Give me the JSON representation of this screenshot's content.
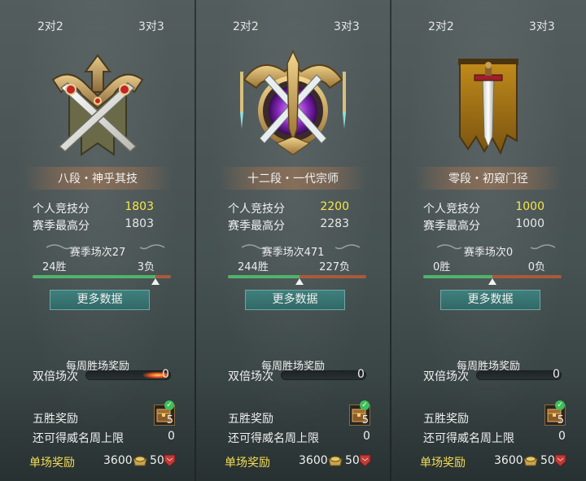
{
  "panels": [
    {
      "tabs": {
        "left": "2对2",
        "right": "3对3"
      },
      "emblem_icon": "crossed-swords-bronze-emblem",
      "rank_name": "八段・神乎其技",
      "personal_score_label": "个人竞技分",
      "personal_score": "1803",
      "season_high_label": "赛季最高分",
      "season_high": "1803",
      "season_matches": "赛季场次27",
      "wins": "24胜",
      "losses": "3负",
      "win_ratio": 0.89,
      "more_button": "更多数据",
      "weekly_title": "每周胜场奖励",
      "double_label": "双倍场次",
      "double_value": "0",
      "five_win_label": "五胜奖励",
      "chest_count": "5",
      "limit_label": "还可得威名周上限",
      "limit_value": "0",
      "single_label": "单场奖励",
      "gold_value": "3600",
      "honor_value": "50"
    },
    {
      "tabs": {
        "left": "2对2",
        "right": "3对3"
      },
      "emblem_icon": "winged-sword-purple-emblem",
      "rank_name": "十二段・一代宗师",
      "personal_score_label": "个人竞技分",
      "personal_score": "2200",
      "season_high_label": "赛季最高分",
      "season_high": "2283",
      "season_matches": "赛季场次471",
      "wins": "244胜",
      "losses": "227负",
      "win_ratio": 0.52,
      "more_button": "更多数据",
      "weekly_title": "每周胜场奖励",
      "double_label": "双倍场次",
      "double_value": "0",
      "five_win_label": "五胜奖励",
      "chest_count": "5",
      "limit_label": "还可得威名周上限",
      "limit_value": "0",
      "single_label": "单场奖励",
      "gold_value": "3600",
      "honor_value": "50"
    },
    {
      "tabs": {
        "left": "2对2",
        "right": "3对3"
      },
      "emblem_icon": "sword-banner-emblem",
      "rank_name": "零段・初窥门径",
      "personal_score_label": "个人竞技分",
      "personal_score": "1000",
      "season_high_label": "赛季最高分",
      "season_high": "1000",
      "season_matches": "赛季场次0",
      "wins": "0胜",
      "losses": "0负",
      "win_ratio": 0.5,
      "more_button": "更多数据",
      "weekly_title": "每周胜场奖励",
      "double_label": "双倍场次",
      "double_value": "0",
      "five_win_label": "五胜奖励",
      "chest_count": "5",
      "limit_label": "还可得威名周上限",
      "limit_value": "0",
      "single_label": "单场奖励",
      "gold_value": "3600",
      "honor_value": "50"
    }
  ],
  "colors": {
    "score_highlight": "#f6e64a",
    "win_bar": "#4fb36c",
    "loss_bar": "#a95a3a",
    "button": "#3a7b78",
    "single_reward_label": "#f3dd55"
  }
}
